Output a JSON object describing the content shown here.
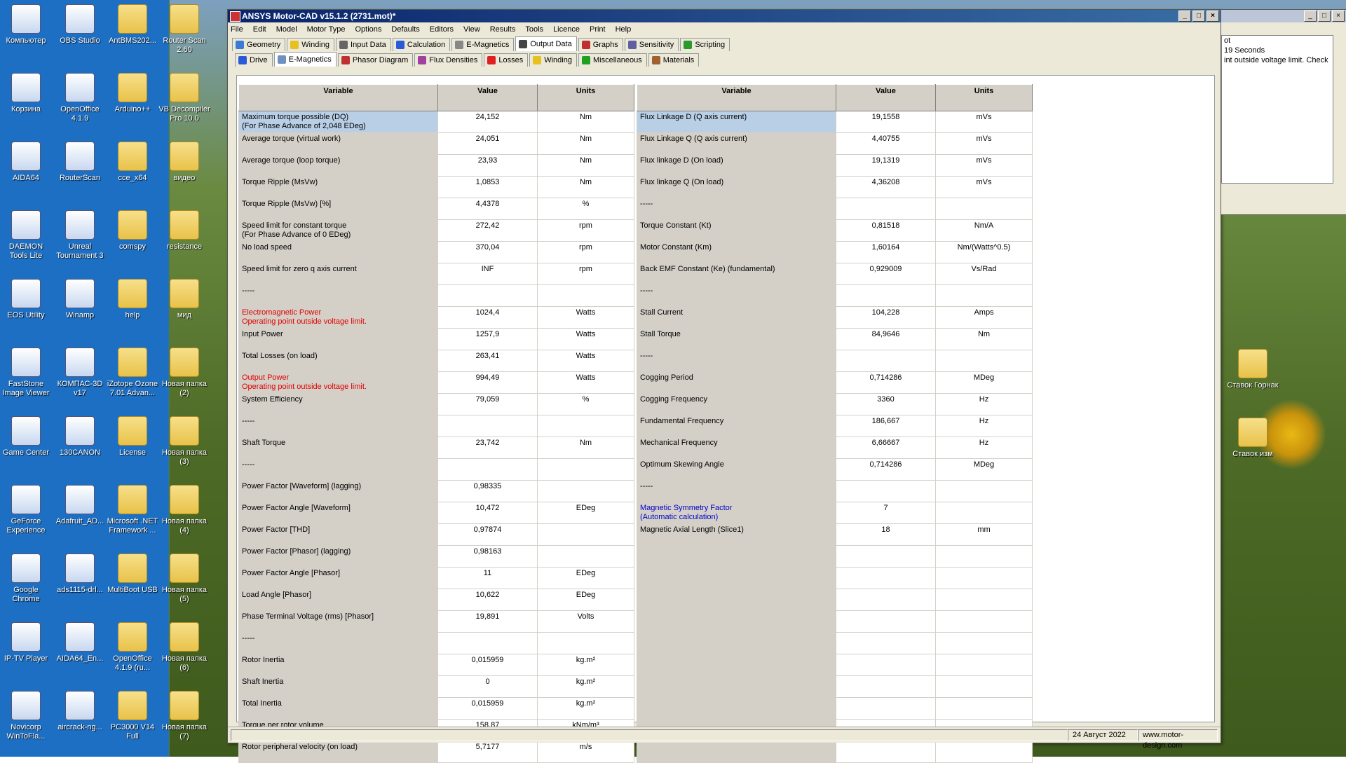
{
  "desktop": {
    "icons_col1": [
      "Компьютер",
      "Корзина",
      "AIDA64",
      "DAEMON Tools Lite",
      "EOS Utility",
      "FastStone Image Viewer",
      "Game Center",
      "GeForce Experience",
      "Google Chrome",
      "IP-TV Player",
      "Novicorp WinToFla..."
    ],
    "icons_col2": [
      "OBS Studio",
      "OpenOffice 4.1.9",
      "RouterScan",
      "Unreal Tournament 3",
      "Winamp",
      "КОМПАС-3D v17",
      "130CANON",
      "Adafruit_AD...",
      "ads1115-drl...",
      "AIDA64_En...",
      "aircrack-ng..."
    ],
    "icons_col3": [
      "AntBMS202...",
      "Arduino++",
      "cce_x64",
      "comspy",
      "help",
      "iZotope Ozone 7.01 Advan...",
      "License",
      "Microsoft .NET Framework ...",
      "MultiBoot USB",
      "OpenOffice 4.1.9 (ru...",
      "PC3000 V14 Full"
    ],
    "icons_col4": [
      "Router Scan 2.60",
      "VB Decompiler Pro 10.0",
      "видео",
      "resistance",
      "мид",
      "Новая папка (2)",
      "Новая папка (3)",
      "Новая папка (4)",
      "Новая папка (5)",
      "Новая папка (6)",
      "Новая папка (7)"
    ],
    "icons_right": [
      "Ставок Горнак",
      "Ставок изм"
    ]
  },
  "window": {
    "title": "ANSYS Motor-CAD v15.1.2 (2731.mot)*",
    "minimize": "_",
    "maximize": "□",
    "close": "×"
  },
  "menu": [
    "File",
    "Edit",
    "Model",
    "Motor Type",
    "Options",
    "Defaults",
    "Editors",
    "View",
    "Results",
    "Tools",
    "Licence",
    "Print",
    "Help"
  ],
  "main_tabs": [
    {
      "label": "Geometry",
      "color": "#3a7bd5"
    },
    {
      "label": "Winding",
      "color": "#e8c020"
    },
    {
      "label": "Input Data",
      "color": "#666"
    },
    {
      "label": "Calculation",
      "color": "#2a5bd7"
    },
    {
      "label": "E-Magnetics",
      "color": "#888"
    },
    {
      "label": "Output Data",
      "color": "#444"
    },
    {
      "label": "Graphs",
      "color": "#c03030"
    },
    {
      "label": "Sensitivity",
      "color": "#6060a0"
    },
    {
      "label": "Scripting",
      "color": "#2a9a2a"
    }
  ],
  "sub_tabs": [
    {
      "label": "Drive",
      "color": "#2a5bd7"
    },
    {
      "label": "E-Magnetics",
      "color": "#7090c0"
    },
    {
      "label": "Phasor Diagram",
      "color": "#c03030"
    },
    {
      "label": "Flux Densities",
      "color": "#a040a0"
    },
    {
      "label": "Losses",
      "color": "#e02020"
    },
    {
      "label": "Winding",
      "color": "#e8c020"
    },
    {
      "label": "Miscellaneous",
      "color": "#20a020"
    },
    {
      "label": "Materials",
      "color": "#a06030"
    }
  ],
  "headers": {
    "variable": "Variable",
    "value": "Value",
    "units": "Units"
  },
  "left_rows": [
    {
      "v": "Maximum torque possible (DQ)",
      "v2": "(For Phase Advance of 2,048 EDeg)",
      "val": "24,152",
      "u": "Nm",
      "sel": true
    },
    {
      "v": "Average torque (virtual work)",
      "val": "24,051",
      "u": "Nm"
    },
    {
      "v": "Average torque (loop torque)",
      "val": "23,93",
      "u": "Nm"
    },
    {
      "v": "Torque Ripple (MsVw)",
      "val": "1,0853",
      "u": "Nm"
    },
    {
      "v": "Torque Ripple (MsVw) [%]",
      "val": "4,4378",
      "u": "%"
    },
    {
      "v": "Speed limit for constant torque",
      "v2": "(For Phase Advance of 0 EDeg)",
      "val": "272,42",
      "u": "rpm"
    },
    {
      "v": "No load speed",
      "val": "370,04",
      "u": "rpm"
    },
    {
      "v": "Speed limit for zero q axis current",
      "val": "INF",
      "u": "rpm"
    },
    {
      "v": "-----",
      "val": "",
      "u": ""
    },
    {
      "v": "Electromagnetic Power",
      "v2": "Operating point outside voltage limit.",
      "val": "1024,4",
      "u": "Watts",
      "red": true
    },
    {
      "v": "Input Power",
      "val": "1257,9",
      "u": "Watts"
    },
    {
      "v": "Total Losses (on load)",
      "val": "263,41",
      "u": "Watts"
    },
    {
      "v": "Output Power",
      "v2": "Operating point outside voltage limit.",
      "val": "994,49",
      "u": "Watts",
      "red": true
    },
    {
      "v": "System Efficiency",
      "val": "79,059",
      "u": "%"
    },
    {
      "v": "-----",
      "val": "",
      "u": ""
    },
    {
      "v": "Shaft Torque",
      "val": "23,742",
      "u": "Nm"
    },
    {
      "v": "-----",
      "val": "",
      "u": ""
    },
    {
      "v": "Power Factor [Waveform] (lagging)",
      "val": "0,98335",
      "u": ""
    },
    {
      "v": "Power Factor Angle [Waveform]",
      "val": "10,472",
      "u": "EDeg"
    },
    {
      "v": "Power Factor [THD]",
      "val": "0,97874",
      "u": ""
    },
    {
      "v": "Power Factor [Phasor] (lagging)",
      "val": "0,98163",
      "u": ""
    },
    {
      "v": "Power Factor Angle [Phasor]",
      "val": "11",
      "u": "EDeg"
    },
    {
      "v": "Load Angle [Phasor]",
      "val": "10,622",
      "u": "EDeg"
    },
    {
      "v": "Phase Terminal Voltage (rms) [Phasor]",
      "val": "19,891",
      "u": "Volts"
    },
    {
      "v": "-----",
      "val": "",
      "u": ""
    },
    {
      "v": "Rotor Inertia",
      "val": "0,015959",
      "u": "kg.m²"
    },
    {
      "v": "Shaft Inertia",
      "val": "0",
      "u": "kg.m²"
    },
    {
      "v": "Total Inertia",
      "val": "0,015959",
      "u": "kg.m²"
    },
    {
      "v": "Torque per rotor volume",
      "val": "158,87",
      "u": "kNm/m³"
    },
    {
      "v": "Rotor peripheral velocity (on load)",
      "val": "5,7177",
      "u": "m/s"
    }
  ],
  "right_rows": [
    {
      "v": "Flux Linkage D (Q axis current)",
      "val": "19,1558",
      "u": "mVs",
      "sel": true
    },
    {
      "v": "Flux Linkage Q (Q axis current)",
      "val": "4,40755",
      "u": "mVs"
    },
    {
      "v": "Flux linkage D (On load)",
      "val": "19,1319",
      "u": "mVs"
    },
    {
      "v": "Flux linkage Q (On load)",
      "val": "4,36208",
      "u": "mVs"
    },
    {
      "v": "-----",
      "val": "",
      "u": ""
    },
    {
      "v": "Torque Constant (Kt)",
      "val": "0,81518",
      "u": "Nm/A"
    },
    {
      "v": "Motor Constant (Km)",
      "val": "1,60164",
      "u": "Nm/(Watts^0.5)"
    },
    {
      "v": "Back EMF Constant (Ke) (fundamental)",
      "val": "0,929009",
      "u": "Vs/Rad"
    },
    {
      "v": "-----",
      "val": "",
      "u": ""
    },
    {
      "v": "Stall Current",
      "val": "104,228",
      "u": "Amps"
    },
    {
      "v": "Stall Torque",
      "val": "84,9646",
      "u": "Nm"
    },
    {
      "v": "-----",
      "val": "",
      "u": ""
    },
    {
      "v": "Cogging Period",
      "val": "0,714286",
      "u": "MDeg"
    },
    {
      "v": "Cogging Frequency",
      "val": "3360",
      "u": "Hz"
    },
    {
      "v": "Fundamental Frequency",
      "val": "186,667",
      "u": "Hz"
    },
    {
      "v": "Mechanical Frequency",
      "val": "6,66667",
      "u": "Hz"
    },
    {
      "v": "Optimum Skewing Angle",
      "val": "0,714286",
      "u": "MDeg"
    },
    {
      "v": "-----",
      "val": "",
      "u": ""
    },
    {
      "v": "Magnetic Symmetry Factor",
      "v2": "(Automatic calculation)",
      "val": "7",
      "u": "",
      "blue": true
    },
    {
      "v": "Magnetic Axial Length (Slice1)",
      "val": "18",
      "u": "mm"
    },
    {
      "v": "",
      "val": "",
      "u": ""
    },
    {
      "v": "",
      "val": "",
      "u": ""
    },
    {
      "v": "",
      "val": "",
      "u": ""
    },
    {
      "v": "",
      "val": "",
      "u": ""
    },
    {
      "v": "",
      "val": "",
      "u": ""
    },
    {
      "v": "",
      "val": "",
      "u": ""
    },
    {
      "v": "",
      "val": "",
      "u": ""
    },
    {
      "v": "",
      "val": "",
      "u": ""
    },
    {
      "v": "",
      "val": "",
      "u": ""
    },
    {
      "v": "",
      "val": "",
      "u": ""
    }
  ],
  "status": {
    "date": "24 Август 2022",
    "site": "www.motor-design.com"
  },
  "side_window": {
    "lines": [
      "ot",
      "19 Seconds",
      "int outside voltage limit. Check"
    ]
  }
}
